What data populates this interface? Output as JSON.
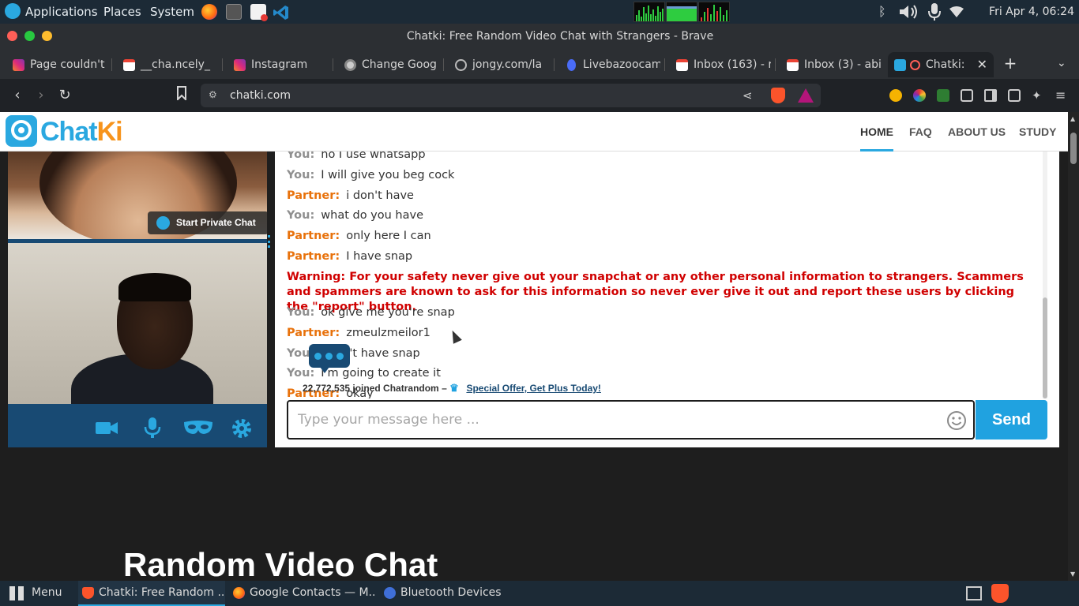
{
  "system_panel": {
    "applications": "Applications",
    "places": "Places",
    "system": "System",
    "clock": "Fri Apr 4, 06:24"
  },
  "window": {
    "title": "Chatki: Free Random Video Chat with Strangers - Brave"
  },
  "tabs": [
    {
      "label": "Page couldn't",
      "icon": "instagram-icon",
      "color": "#d62976"
    },
    {
      "label": "__cha.ncely_",
      "icon": "gmail-icon",
      "color": "#ea4335"
    },
    {
      "label": "Instagram",
      "icon": "instagram-icon",
      "color": "#d62976"
    },
    {
      "label": "Change Goog",
      "icon": "chrome-icon",
      "color": "#cccccc"
    },
    {
      "label": "jongy.com/la",
      "icon": "globe-icon",
      "color": "#aaaaaa"
    },
    {
      "label": "Livebazoocam",
      "icon": "webcam-icon",
      "color": "#4a6cf7"
    },
    {
      "label": "Inbox (163) - r",
      "icon": "gmail-icon",
      "color": "#ea4335"
    },
    {
      "label": "Inbox (3) - abi",
      "icon": "gmail-icon",
      "color": "#ea4335"
    },
    {
      "label": "Chatki:",
      "icon": "chatki-icon",
      "color": "#2aa8e0"
    }
  ],
  "address_bar": {
    "url": "chatki.com"
  },
  "site": {
    "logo_main": "Chat",
    "logo_accent": "Ki",
    "nav": [
      "HOME",
      "FAQ",
      "ABOUT US",
      "STUDY"
    ]
  },
  "video": {
    "private_chat": "Start Private Chat"
  },
  "chat": {
    "messages": [
      {
        "who": "You:",
        "role": "you",
        "text": "no I use whatsapp"
      },
      {
        "who": "You:",
        "role": "you",
        "text": "I will give you beg cock"
      },
      {
        "who": "Partner:",
        "role": "partner",
        "text": "i don't have"
      },
      {
        "who": "You:",
        "role": "you",
        "text": "what do you have"
      },
      {
        "who": "Partner:",
        "role": "partner",
        "text": "only here I can"
      },
      {
        "who": "Partner:",
        "role": "partner",
        "text": "I have snap"
      },
      {
        "who": "You:",
        "role": "you",
        "text": "ok give me you're snap"
      },
      {
        "who": "Partner:",
        "role": "partner",
        "text": "zmeulzmeilor1"
      },
      {
        "who": "You:",
        "role": "you",
        "text": "I don't have snap"
      },
      {
        "who": "You:",
        "role": "you",
        "text": "I'm going to create it"
      },
      {
        "who": "Partner:",
        "role": "partner",
        "text": "okay"
      }
    ],
    "warning": "Warning: For your safety never give out your snapchat or any other personal information to strangers. Scammers and spammers are known to ask for this information so never ever give it out and report these users by clicking the \"report\" button.",
    "promo_count": "22,772,535 joined Chatrandom –",
    "promo_link": "Special Offer, Get Plus Today!",
    "input_placeholder": "Type your message here ...",
    "send": "Send"
  },
  "hero": {
    "title": "Random Video Chat"
  },
  "taskbar": {
    "menu": "Menu",
    "items": [
      {
        "label": "Chatki: Free Random ...",
        "icon": "brave-icon",
        "color": "#fb542b"
      },
      {
        "label": "Google Contacts — M...",
        "icon": "firefox-icon",
        "color": "#ff9500"
      },
      {
        "label": "Bluetooth Devices",
        "icon": "bluetooth-icon",
        "color": "#3f6fd8"
      }
    ]
  },
  "colors": {
    "brand_blue": "#2aa8e0",
    "brand_orange": "#f7941d",
    "warning_red": "#d00000",
    "partner_orange": "#e8720c"
  }
}
